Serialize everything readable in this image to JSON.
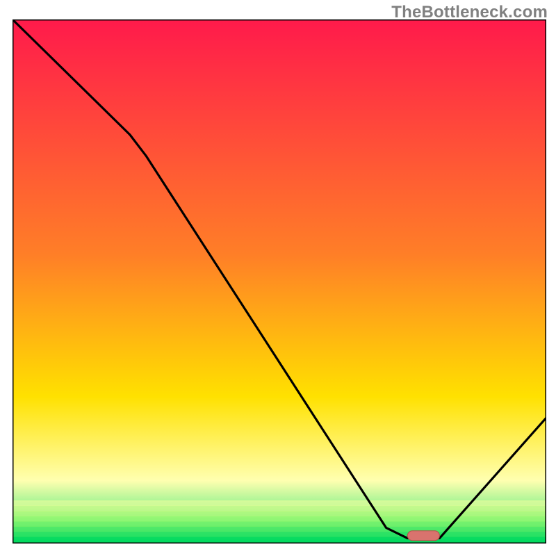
{
  "watermark": "TheBottleneck.com",
  "colors": {
    "gradient_top": "#ff1a4b",
    "gradient_mid1": "#ff7f27",
    "gradient_mid2": "#ffe100",
    "gradient_pale": "#ffffb0",
    "gradient_bottom": "#00e060",
    "curve": "#000000",
    "frame": "#000000",
    "marker_fill": "#d9736e",
    "marker_stroke": "#b84f4a"
  },
  "chart_data": {
    "type": "line",
    "title": "",
    "xlabel": "",
    "ylabel": "",
    "xlim": [
      0,
      100
    ],
    "ylim": [
      0,
      100
    ],
    "grid": false,
    "curve": [
      {
        "x": 0,
        "y": 100
      },
      {
        "x": 22,
        "y": 78
      },
      {
        "x": 25,
        "y": 74
      },
      {
        "x": 70,
        "y": 3
      },
      {
        "x": 74,
        "y": 1
      },
      {
        "x": 80,
        "y": 1
      },
      {
        "x": 100,
        "y": 24
      }
    ],
    "marker": {
      "x0": 74,
      "x1": 80,
      "y": 1.5,
      "rx": 2
    },
    "bands": [
      {
        "stop": 0.0,
        "color_key": "gradient_top"
      },
      {
        "stop": 0.45,
        "color_key": "gradient_mid1"
      },
      {
        "stop": 0.72,
        "color_key": "gradient_mid2"
      },
      {
        "stop": 0.88,
        "color_key": "gradient_pale"
      },
      {
        "stop": 1.0,
        "color_key": "gradient_bottom"
      }
    ]
  }
}
